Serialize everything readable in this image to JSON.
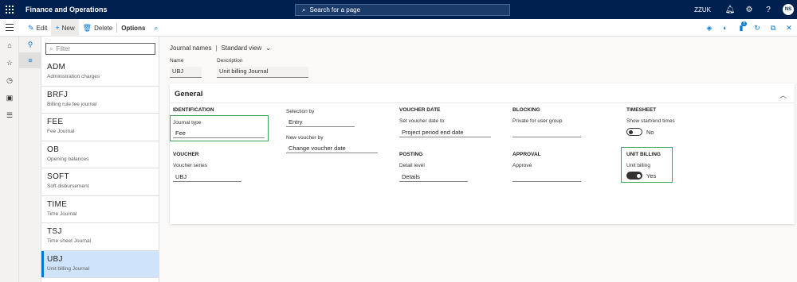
{
  "topbar": {
    "app_title": "Finance and Operations",
    "search_placeholder": "Search for a page",
    "company": "ZZUK",
    "avatar_initials": "NS"
  },
  "actions": {
    "edit": "Edit",
    "new": "New",
    "delete": "Delete",
    "options": "Options",
    "attachments_badge": "0"
  },
  "filter": {
    "placeholder": "Filter"
  },
  "journals": [
    {
      "code": "ADM",
      "description": "Administration charges"
    },
    {
      "code": "BRFJ",
      "description": "Billing rule fee journal"
    },
    {
      "code": "FEE",
      "description": "Fee Journal"
    },
    {
      "code": "OB",
      "description": "Opening balances"
    },
    {
      "code": "SOFT",
      "description": "Soft disbursement"
    },
    {
      "code": "TIME",
      "description": "Time Journal"
    },
    {
      "code": "TSJ",
      "description": "Time sheet Journal"
    },
    {
      "code": "UBJ",
      "description": "Unit billing Journal"
    }
  ],
  "view": {
    "page": "Journal names",
    "separator": "|",
    "view_name": "Standard view"
  },
  "header": {
    "name_label": "Name",
    "name_value": "UBJ",
    "description_label": "Description",
    "description_value": "Unit billing Journal"
  },
  "general": {
    "title": "General",
    "identification": {
      "group": "IDENTIFICATION",
      "journal_type_label": "Journal type",
      "journal_type_value": "Fee"
    },
    "voucher": {
      "group": "VOUCHER",
      "series_label": "Voucher series",
      "series_value": "UBJ"
    },
    "selection_by_label": "Selection by",
    "selection_by_value": "Entry",
    "new_voucher_by_label": "New voucher by",
    "new_voucher_by_value": "Change voucher date",
    "voucher_date": {
      "group": "VOUCHER DATE",
      "set_label": "Set voucher date to",
      "set_value": "Project period end date"
    },
    "posting": {
      "group": "POSTING",
      "detail_label": "Detail level",
      "detail_value": "Details"
    },
    "blocking": {
      "group": "BLOCKING",
      "private_label": "Private for user group",
      "private_value": ""
    },
    "approval": {
      "group": "APPROVAL",
      "approve_label": "Approve",
      "approve_value": ""
    },
    "timesheet": {
      "group": "TIMESHEET",
      "show_label": "Show start/end times",
      "show_value": "No"
    },
    "unit_billing": {
      "group": "UNIT BILLING",
      "unit_label": "Unit billing",
      "unit_value": "Yes"
    }
  },
  "colors": {
    "topbar": "#002050",
    "accent": "#0078d4",
    "highlight": "#3aa655",
    "selected_row": "#cfe4fa"
  }
}
